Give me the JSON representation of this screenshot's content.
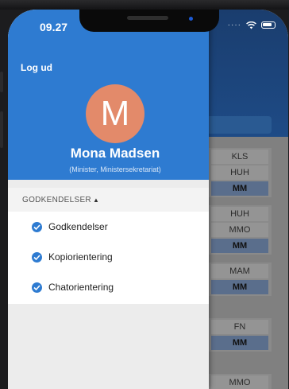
{
  "status_bar": {
    "time": "09.27"
  },
  "drawer": {
    "logout_label": "Log ud",
    "avatar_initial": "M",
    "user_name": "Mona Madsen",
    "user_role": "(Minister, Ministersekretariat)",
    "section_label": "GODKENDELSER",
    "section_chevron": "▲",
    "menu_items": [
      {
        "label": "Godkendelser"
      },
      {
        "label": "Kopiorientering"
      },
      {
        "label": "Chatorientering"
      }
    ]
  },
  "background_cards": [
    {
      "cells": [
        "KLS",
        "HUH",
        "MM"
      ]
    },
    {
      "cells": [
        "HUH",
        "MMO",
        "MM"
      ]
    },
    {
      "cells": [
        "MAM",
        "MM"
      ]
    },
    {
      "cells": [
        "FN",
        "MM"
      ]
    },
    {
      "cells": [
        "MMO"
      ]
    }
  ],
  "colors": {
    "drawer_header": "#2e7bd1",
    "avatar": "#e38a6a",
    "check_icon": "#2e7bd1",
    "app_header": "#1e4b86"
  }
}
